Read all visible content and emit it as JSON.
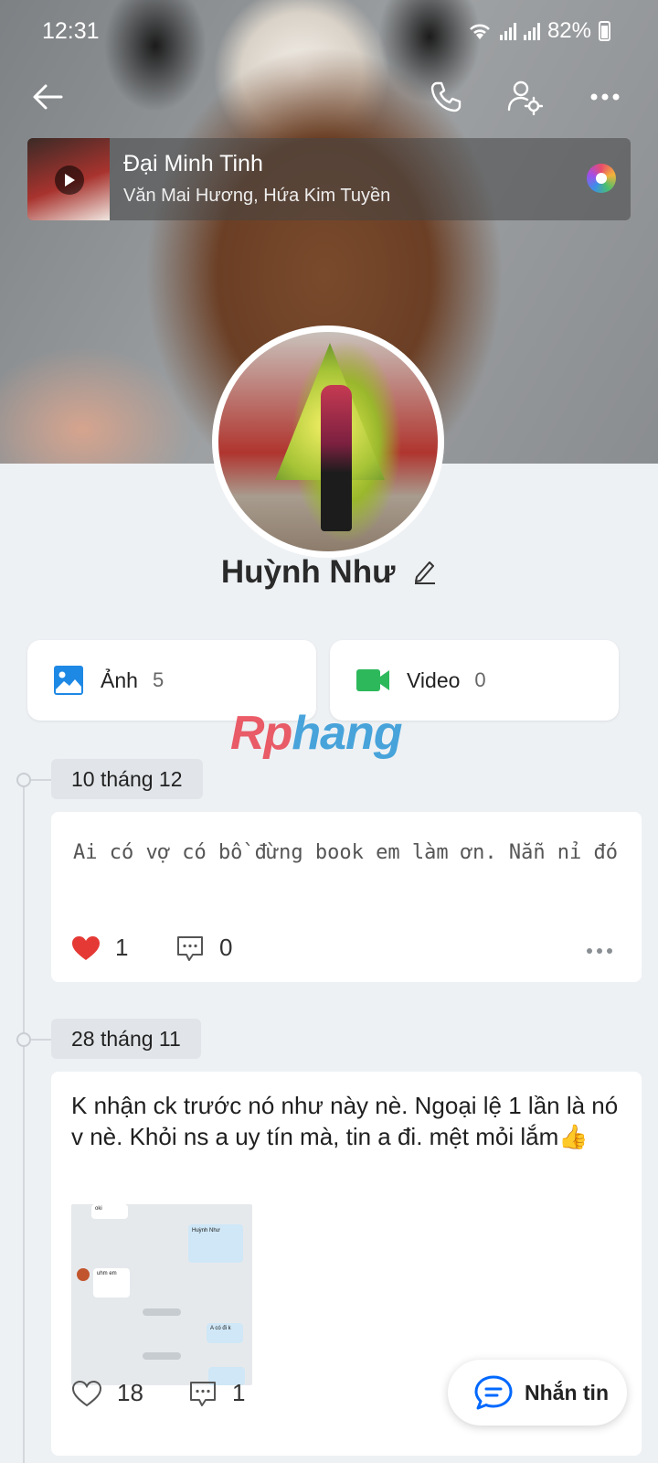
{
  "status_bar": {
    "time": "12:31",
    "battery": "82%"
  },
  "music": {
    "title": "Đại Minh Tinh",
    "artist": "Văn Mai Hương, Hứa Kim Tuyền"
  },
  "profile": {
    "name": "Huỳnh Như"
  },
  "media_cards": [
    {
      "label": "Ảnh",
      "count": "5"
    },
    {
      "label": "Video",
      "count": "0"
    }
  ],
  "watermark": {
    "part1": "Rp",
    "part2": "hang"
  },
  "posts": [
    {
      "date": "10 tháng 12",
      "text": "Ai có vợ có bồ đừng book em làm ơn. Nẵn nỉ đó",
      "likes": "1",
      "comments": "0"
    },
    {
      "date": "28 tháng 11",
      "text": "K nhận ck trước nó như này nè. Ngoại lệ 1 lần là nó v nè. Khỏi ns a uy tín mà, tin a đi. mệt mỏi lắm👍",
      "likes": "18",
      "comments": "1"
    }
  ],
  "screenshot_thumb": {
    "msg1": "oki",
    "msg2": "Huỳnh Như",
    "msg3": "uhm em",
    "msg4": "A có đi k"
  },
  "fab": {
    "label": "Nhắn tin"
  },
  "colors": {
    "like_red": "#e53935",
    "photo_blue": "#1e88e5",
    "video_green": "#2eb85c",
    "accent": "#0068ff"
  }
}
